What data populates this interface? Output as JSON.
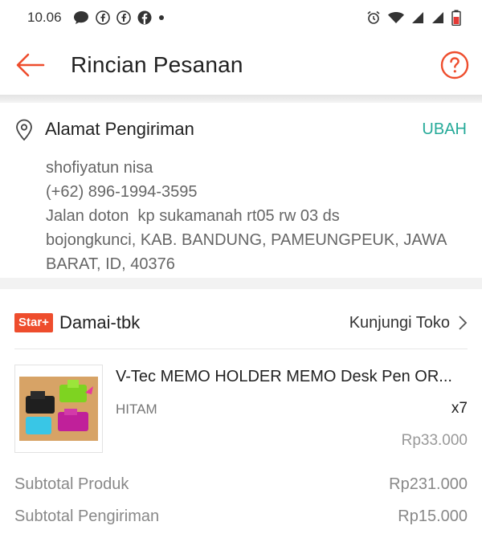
{
  "status_bar": {
    "time": "10.06",
    "left_icons": [
      "chat-bubble-icon",
      "facebook-icon",
      "facebook-icon",
      "facebook-icon",
      "dot-icon"
    ],
    "right_icons": [
      "alarm-icon",
      "wifi-icon",
      "signal-icon",
      "signal-icon",
      "battery-icon"
    ]
  },
  "header": {
    "title": "Rincian Pesanan",
    "back_icon": "back-arrow-icon",
    "help_icon": "help-icon",
    "accent": "#ee4d2d"
  },
  "address": {
    "title": "Alamat Pengiriman",
    "action": "UBAH",
    "name": "shofiyatun nisa",
    "phone": "(+62) 896-1994-3595",
    "line1": "Jalan doton  kp sukamanah rt05 rw 03 ds",
    "line2": "bojongkunci, KAB. BANDUNG, PAMEUNGPEUK, JAWA",
    "line3": "BARAT, ID, 40376",
    "action_color": "#26aa99"
  },
  "shop": {
    "badge": "Star+",
    "name": "Damai-tbk",
    "visit": "Kunjungi Toko"
  },
  "product": {
    "name": "V-Tec MEMO HOLDER MEMO Desk Pen OR...",
    "variant": "HITAM",
    "qty": "x7",
    "price": "Rp33.000"
  },
  "summary": {
    "subtotal_product_label": "Subtotal Produk",
    "subtotal_product_value": "Rp231.000",
    "subtotal_shipping_label": "Subtotal Pengiriman",
    "subtotal_shipping_value": "Rp15.000"
  }
}
